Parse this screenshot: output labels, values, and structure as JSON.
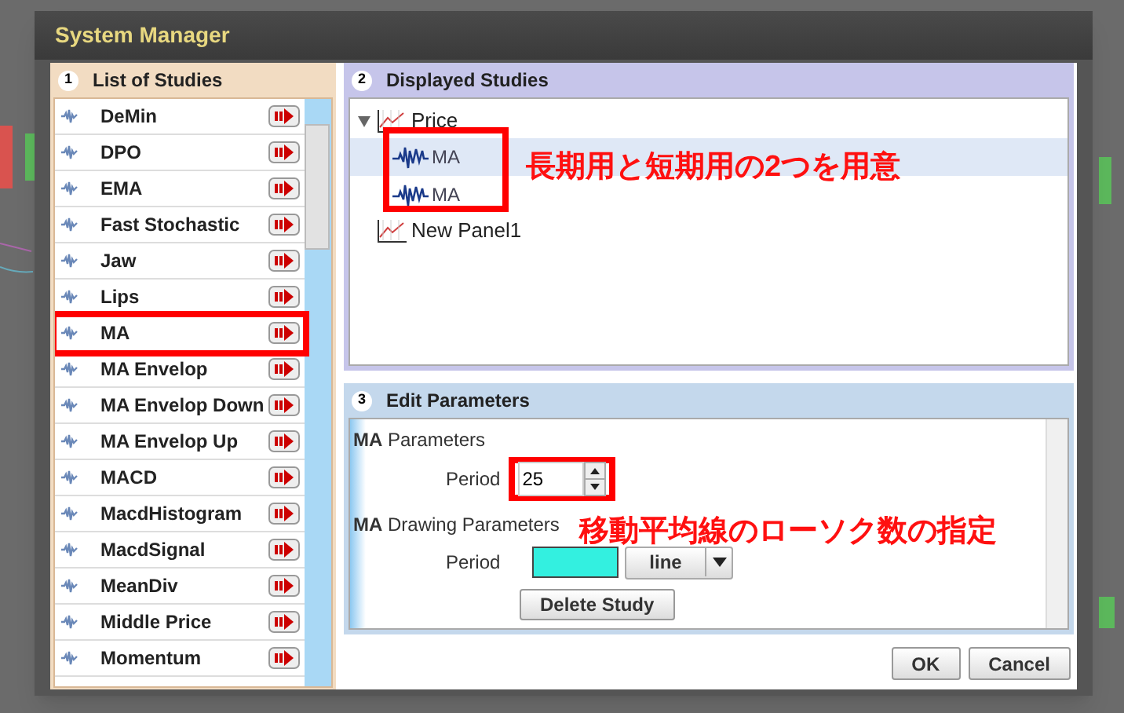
{
  "window": {
    "title": "System Manager"
  },
  "list_of_studies": {
    "number": "1",
    "title": "List of Studies",
    "items": [
      {
        "label": "DeMin",
        "boxed": false
      },
      {
        "label": "DPO",
        "boxed": false
      },
      {
        "label": "EMA",
        "boxed": false
      },
      {
        "label": "Fast Stochastic",
        "boxed": false
      },
      {
        "label": "Jaw",
        "boxed": false
      },
      {
        "label": "Lips",
        "boxed": false
      },
      {
        "label": "MA",
        "boxed": true
      },
      {
        "label": "MA Envelop",
        "boxed": false
      },
      {
        "label": "MA Envelop Down",
        "boxed": false
      },
      {
        "label": "MA Envelop Up",
        "boxed": false
      },
      {
        "label": "MACD",
        "boxed": false
      },
      {
        "label": "MacdHistogram",
        "boxed": false
      },
      {
        "label": "MacdSignal",
        "boxed": false
      },
      {
        "label": "MeanDiv",
        "boxed": false
      },
      {
        "label": "Middle Price",
        "boxed": false
      },
      {
        "label": "Momentum",
        "boxed": false
      }
    ]
  },
  "displayed_studies": {
    "number": "2",
    "title": "Displayed Studies",
    "tree": [
      {
        "label": "Price",
        "expanded": true,
        "children_boxed": true,
        "children": [
          {
            "label": "MA",
            "selected": true
          },
          {
            "label": "MA",
            "selected": false
          }
        ]
      },
      {
        "label": "New Panel1"
      }
    ],
    "note": "長期用と短期用の2つを用意"
  },
  "edit_parameters": {
    "number": "3",
    "title": "Edit Parameters",
    "section_1": {
      "prefix": "MA",
      "title": "Parameters"
    },
    "period": {
      "label": "Period",
      "value": "25",
      "boxed": true
    },
    "note": "移動平均線のローソク数の指定",
    "section_2": {
      "prefix": "MA",
      "title": "Drawing Parameters"
    },
    "drawing": {
      "label": "Period",
      "color": "#33f0e0",
      "style": "line"
    },
    "delete_button": "Delete Study"
  },
  "buttons": [
    "OK",
    "Cancel"
  ]
}
